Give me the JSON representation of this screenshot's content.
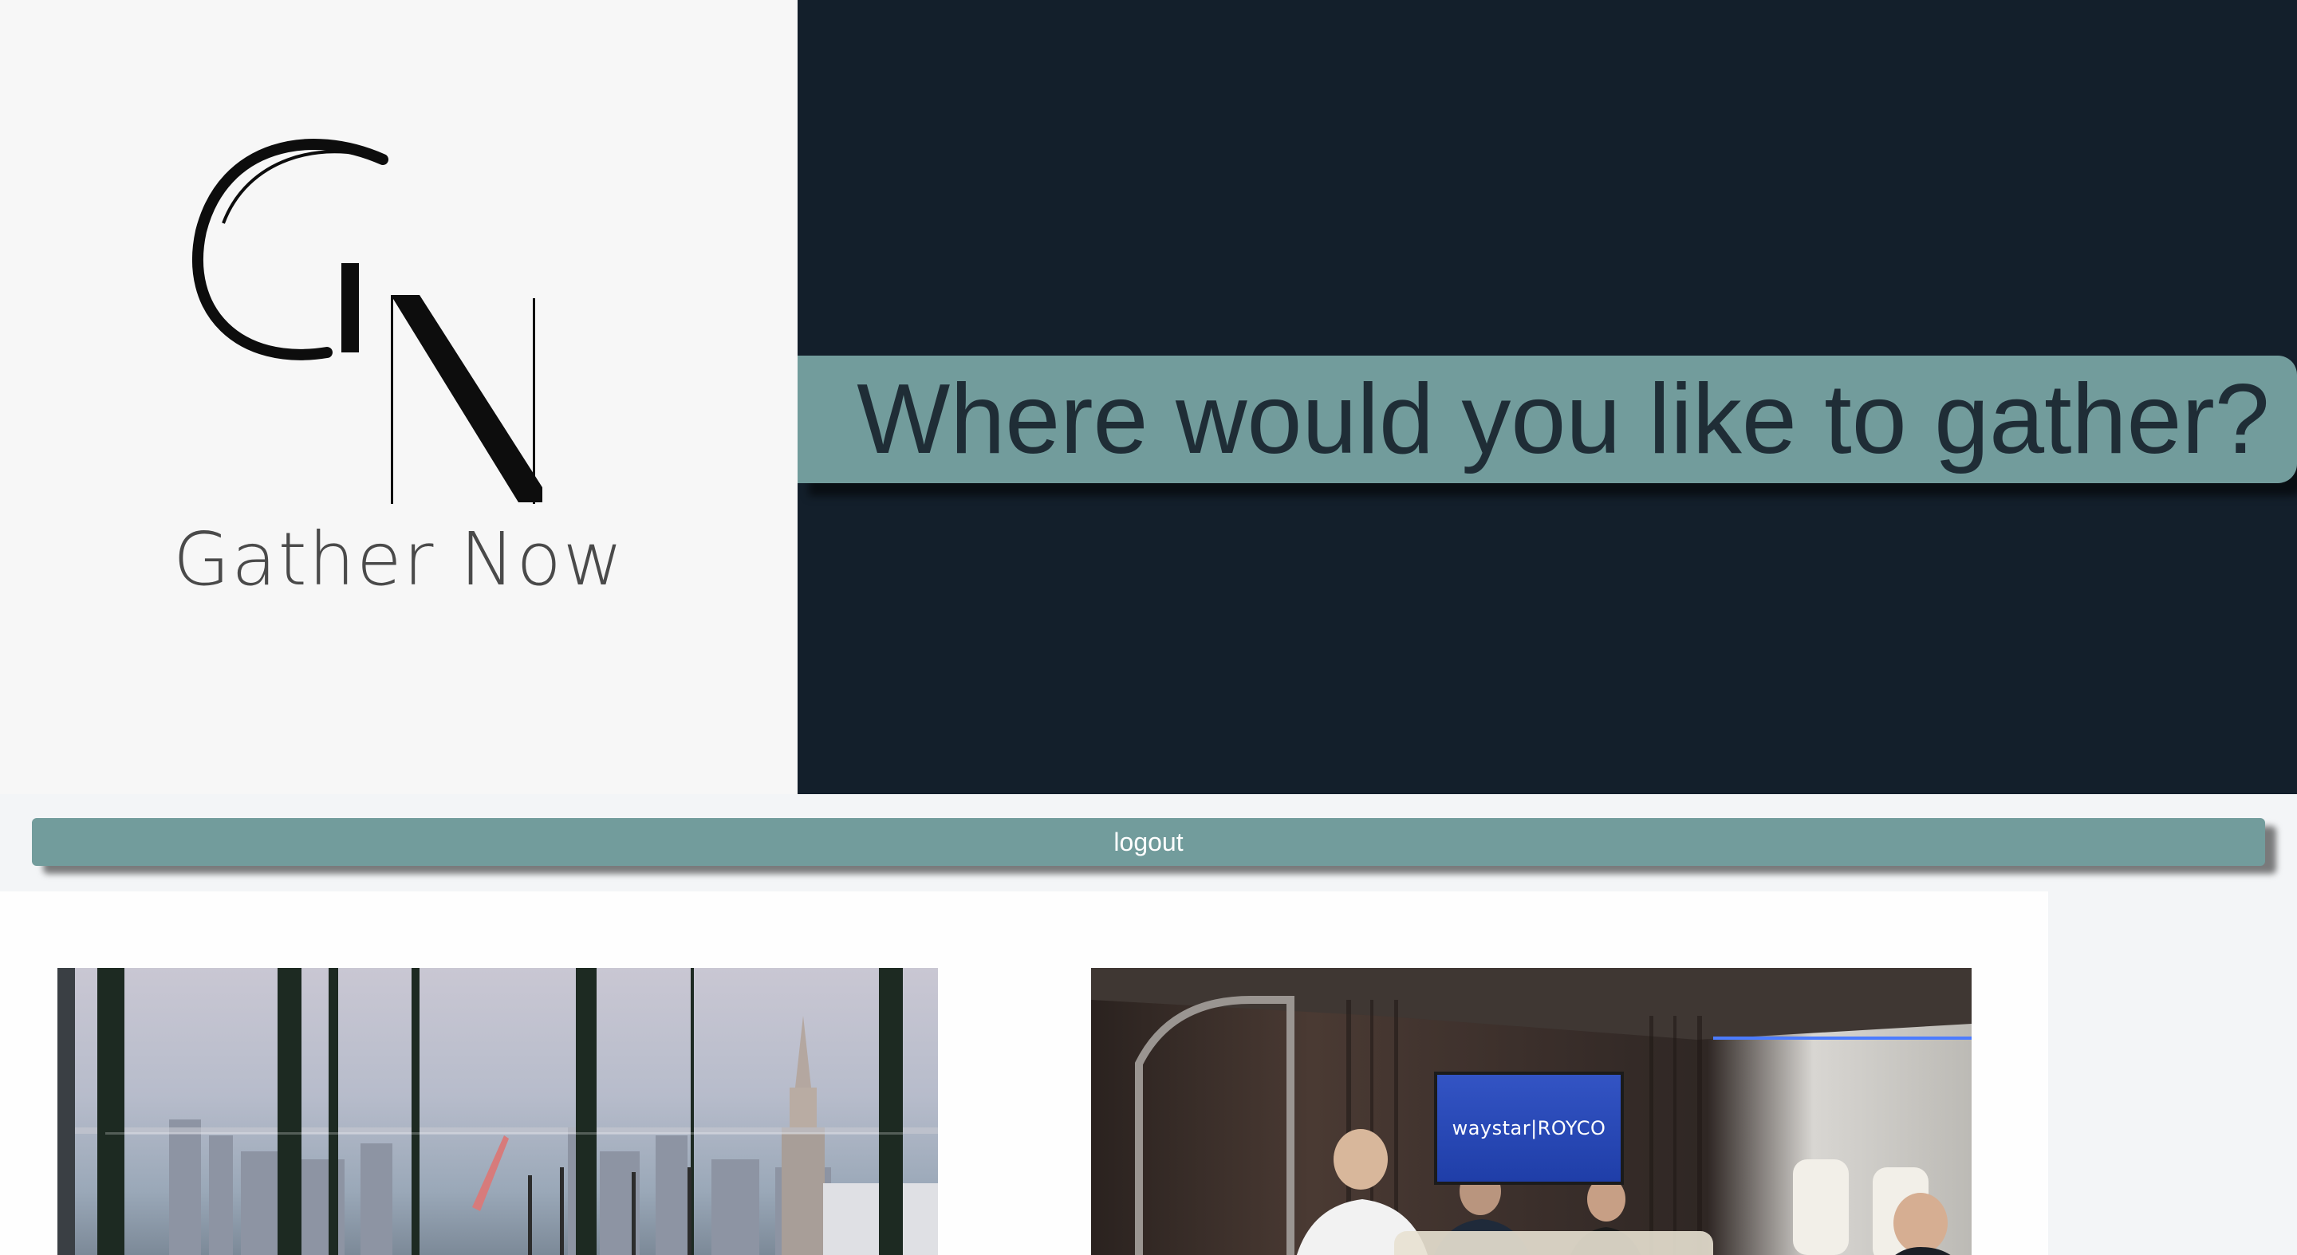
{
  "brand": {
    "logo_text": "Gather Now",
    "logo_monogram": "GN"
  },
  "hero": {
    "title": "Where would you like to gather?"
  },
  "nav": {
    "logout_label": "logout"
  },
  "venues": [
    {
      "image": "city-skyline-window-venue"
    },
    {
      "image": "private-jet-interior-venue",
      "screen_text": "waystar|ROYCO"
    }
  ],
  "colors": {
    "accent": "#729c9c",
    "hero_bg": "#131f2b",
    "logo_bg": "#f7f7f7",
    "title_text": "#1f2d36"
  }
}
